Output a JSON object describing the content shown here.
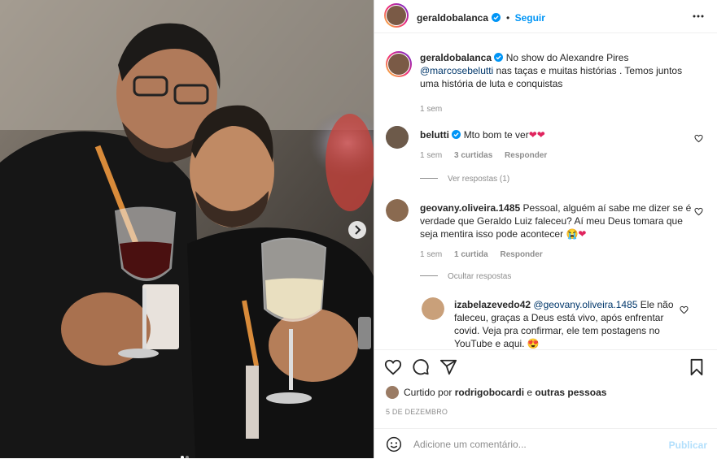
{
  "post": {
    "author": "geraldobalanca",
    "follow_label": "Seguir",
    "more_icon": "more-horizontal-icon",
    "caption_author": "geraldobalanca",
    "caption_prefix": "No show do Alexandre Pires ",
    "caption_mention": "@marcosebelutti",
    "caption_suffix": " nas taças e muitas histórias . Temos juntos uma história de luta e conquistas",
    "caption_time": "1 sem"
  },
  "comments": [
    {
      "user": "belutti",
      "text": "Mto bom te ver",
      "emoji": "❤❤",
      "time": "1 sem",
      "likes": "3 curtidas",
      "reply_label": "Responder",
      "replies_toggle": "Ver respostas (1)"
    },
    {
      "user": "geovany.oliveira.1485",
      "text": "Pessoal, alguém aí sabe me dizer se é verdade que Geraldo Luiz faleceu? Aí meu Deus tomara que seja mentira isso pode acontecer",
      "emoji": "😭❤",
      "time": "1 sem",
      "likes": "1 curtida",
      "reply_label": "Responder",
      "replies_toggle": "Ocultar respostas"
    }
  ],
  "reply": {
    "user": "izabelazevedo42",
    "mention": "@geovany.oliveira.1485",
    "text": " Ele não faleceu, graças a Deus está vivo, após enfrentar covid. Veja pra confirmar, ele tem postagens no YouTube e aqui.",
    "emoji": "😍"
  },
  "likes_line": {
    "prefix": "Curtido por ",
    "user": "rodrigobocardi",
    "middle": " e ",
    "others": "outras pessoas"
  },
  "date_label": "5 DE DEZEMBRO",
  "composer": {
    "placeholder": "Adicione um comentário...",
    "publish_label": "Publicar"
  },
  "colors": {
    "accent": "#0095f6",
    "heart": "#ed4956",
    "publish_disabled": "#b2dffc"
  }
}
